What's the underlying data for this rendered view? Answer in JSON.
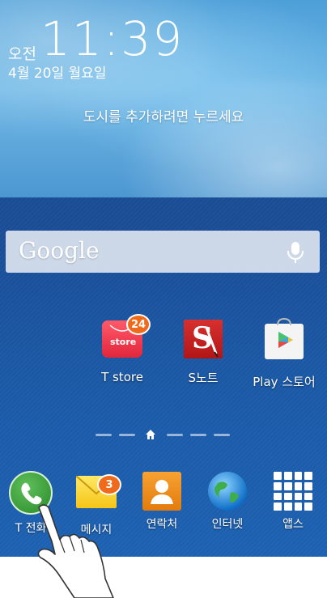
{
  "clock": {
    "ampm": "오전",
    "time": "11:39",
    "date": "4월 20일 월요일",
    "prompt": "도시를 추가하려면 누르세요"
  },
  "search": {
    "logo": "Google",
    "mic_icon": "mic-icon"
  },
  "apps": [
    {
      "label": "T store",
      "badge": "24",
      "icon": "tstore-icon",
      "tile_text": "store"
    },
    {
      "label": "S노트",
      "icon": "snote-icon",
      "tile_text": "S"
    },
    {
      "label": "Play 스토어",
      "icon": "play-store-icon"
    }
  ],
  "dock": [
    {
      "label": "T 전화",
      "icon": "phone-icon"
    },
    {
      "label": "메시지",
      "badge": "3",
      "icon": "mail-icon"
    },
    {
      "label": "연락처",
      "icon": "contacts-icon"
    },
    {
      "label": "인터넷",
      "icon": "globe-icon"
    },
    {
      "label": "앱스",
      "icon": "apps-grid-icon"
    }
  ],
  "pager": {
    "current_page": 3,
    "total_pages": 6
  },
  "colors": {
    "badge": "#ef6a1a",
    "wallpaper": "#1d4f96"
  }
}
